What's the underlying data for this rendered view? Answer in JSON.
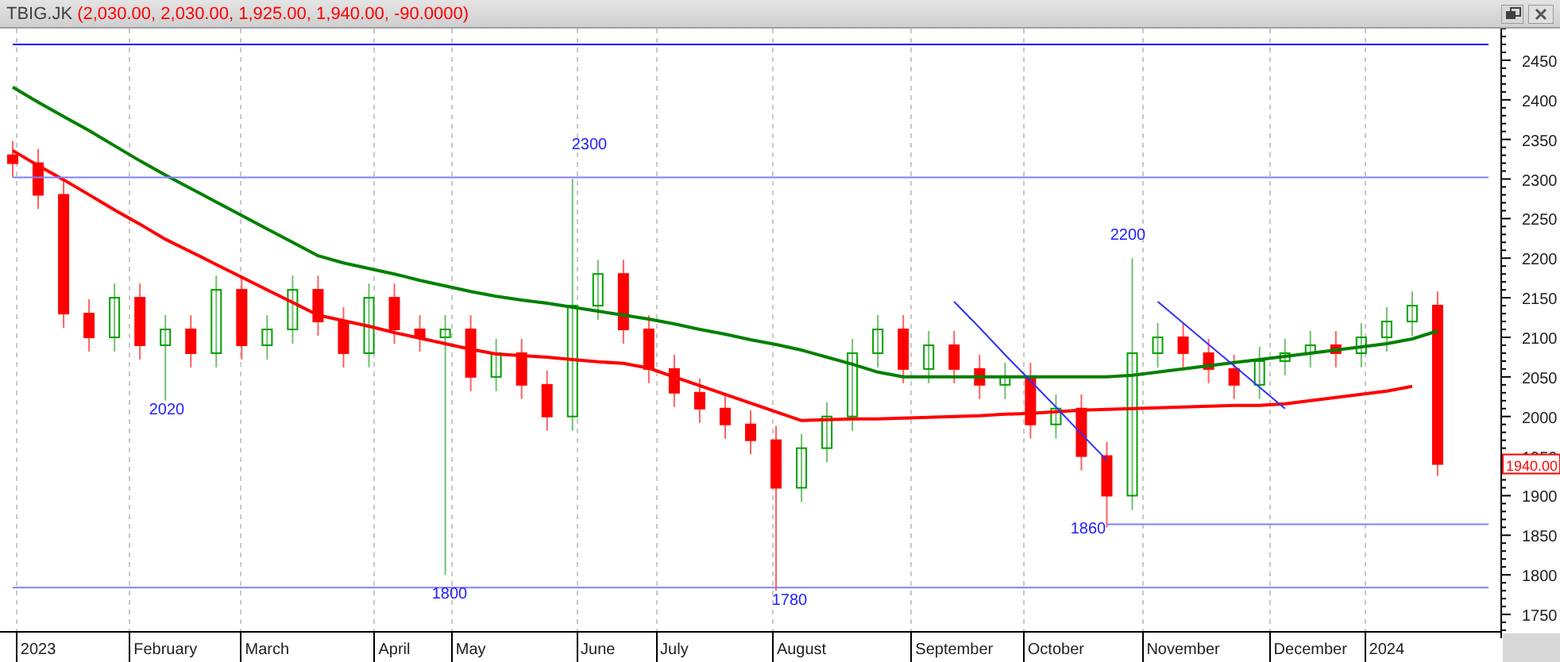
{
  "header": {
    "symbol": "TBIG.JK",
    "ohlc": "(2,030.00, 2,030.00, 1,925.00, 1,940.00, -90.0000)"
  },
  "chart": {
    "last_price_label": "1940.00",
    "chart_data": {
      "type": "candlestick",
      "categories": [
        null,
        "2023",
        null,
        null,
        null,
        null,
        "February",
        null,
        null,
        null,
        "March",
        null,
        null,
        null,
        null,
        "April",
        null,
        null,
        "May",
        null,
        null,
        null,
        null,
        "June",
        null,
        null,
        "July",
        null,
        null,
        null,
        null,
        "August",
        null,
        null,
        null,
        null,
        null,
        "September",
        null,
        null,
        null,
        "October",
        null,
        null,
        null,
        null,
        "November",
        null,
        null,
        null,
        null,
        "December",
        null,
        null,
        "2024",
        null,
        null,
        null,
        null
      ],
      "ylim": [
        1728,
        2490
      ],
      "yticks": [
        1750,
        1800,
        1850,
        1900,
        1950,
        2000,
        2050,
        2100,
        2150,
        2200,
        2250,
        2300,
        2350,
        2400,
        2450
      ],
      "ohlc": [
        [
          2330,
          2348,
          2302,
          2320
        ],
        [
          2320,
          2338,
          2262,
          2280
        ],
        [
          2280,
          2298,
          2112,
          2130
        ],
        [
          2130,
          2148,
          2082,
          2100
        ],
        [
          2100,
          2168,
          2082,
          2150
        ],
        [
          2150,
          2168,
          2072,
          2090
        ],
        [
          2090,
          2128,
          2020,
          2110
        ],
        [
          2110,
          2128,
          2062,
          2080
        ],
        [
          2080,
          2178,
          2062,
          2160
        ],
        [
          2160,
          2178,
          2072,
          2090
        ],
        [
          2090,
          2128,
          2072,
          2110
        ],
        [
          2110,
          2178,
          2092,
          2160
        ],
        [
          2160,
          2178,
          2102,
          2120
        ],
        [
          2120,
          2138,
          2062,
          2080
        ],
        [
          2080,
          2168,
          2062,
          2150
        ],
        [
          2150,
          2168,
          2092,
          2110
        ],
        [
          2110,
          2128,
          2082,
          2100
        ],
        [
          2100,
          2128,
          1800,
          2110
        ],
        [
          2110,
          2128,
          2032,
          2050
        ],
        [
          2050,
          2098,
          2032,
          2080
        ],
        [
          2080,
          2098,
          2022,
          2040
        ],
        [
          2040,
          2058,
          1982,
          2000
        ],
        [
          2000,
          2300,
          1982,
          2140
        ],
        [
          2140,
          2198,
          2122,
          2180
        ],
        [
          2180,
          2198,
          2092,
          2110
        ],
        [
          2110,
          2128,
          2042,
          2060
        ],
        [
          2060,
          2078,
          2012,
          2030
        ],
        [
          2030,
          2048,
          1992,
          2010
        ],
        [
          2010,
          2028,
          1972,
          1990
        ],
        [
          1990,
          2008,
          1952,
          1970
        ],
        [
          1970,
          1988,
          1780,
          1910
        ],
        [
          1910,
          1978,
          1892,
          1960
        ],
        [
          1960,
          2018,
          1942,
          2000
        ],
        [
          2000,
          2098,
          1982,
          2080
        ],
        [
          2080,
          2128,
          2062,
          2110
        ],
        [
          2110,
          2128,
          2042,
          2060
        ],
        [
          2060,
          2108,
          2042,
          2090
        ],
        [
          2090,
          2108,
          2042,
          2060
        ],
        [
          2060,
          2078,
          2022,
          2040
        ],
        [
          2040,
          2068,
          2022,
          2050
        ],
        [
          2050,
          2068,
          1972,
          1990
        ],
        [
          1990,
          2028,
          1972,
          2010
        ],
        [
          2010,
          2028,
          1932,
          1950
        ],
        [
          1950,
          1968,
          1860,
          1900
        ],
        [
          1900,
          2200,
          1882,
          2080
        ],
        [
          2080,
          2118,
          2062,
          2100
        ],
        [
          2100,
          2118,
          2062,
          2080
        ],
        [
          2080,
          2098,
          2042,
          2060
        ],
        [
          2060,
          2078,
          2022,
          2040
        ],
        [
          2040,
          2088,
          2022,
          2070
        ],
        [
          2070,
          2098,
          2052,
          2080
        ],
        [
          2080,
          2108,
          2062,
          2090
        ],
        [
          2090,
          2108,
          2062,
          2080
        ],
        [
          2080,
          2118,
          2062,
          2100
        ],
        [
          2100,
          2138,
          2082,
          2120
        ],
        [
          2120,
          2158,
          2102,
          2140
        ],
        [
          2140,
          2158,
          1925,
          1940
        ],
        null,
        null
      ],
      "series": [
        {
          "type": "line",
          "color": "#008000",
          "values": [
            2416,
            2397,
            2379,
            2361,
            2342,
            2323,
            2305,
            2288,
            2271,
            2254,
            2237,
            2220,
            2203,
            2194,
            2187,
            2180,
            2172,
            2165,
            2158,
            2152,
            2147,
            2143,
            2138,
            2133,
            2128,
            2123,
            2117,
            2110,
            2104,
            2097,
            2091,
            2084,
            2075,
            2066,
            2056,
            2050,
            2050,
            2050,
            2050,
            2050,
            2050,
            2050,
            2050,
            2050,
            2052,
            2056,
            2060,
            2064,
            2068,
            2072,
            2076,
            2080,
            2084,
            2088,
            2092,
            2098,
            2108,
            null,
            null
          ]
        },
        {
          "type": "line",
          "color": "#ff0000",
          "values": [
            2336,
            2317,
            2299,
            2280,
            2261,
            2243,
            2224,
            2208,
            2192,
            2176,
            2160,
            2144,
            2128,
            2121,
            2114,
            2106,
            2099,
            2092,
            2085,
            2079,
            2077,
            2075,
            2072,
            2069,
            2067,
            2061,
            2050,
            2039,
            2028,
            2017,
            2006,
            1995,
            1996,
            1997,
            1997,
            1998,
            1999,
            2000,
            2001,
            2003,
            2004,
            2006,
            2008,
            2009,
            2010,
            2011,
            2012,
            2013,
            2014,
            2014,
            2016,
            2020,
            2024,
            2028,
            2032,
            2038,
            null,
            null,
            null
          ]
        },
        {
          "type": "line",
          "color": "#3030ff",
          "values": [
            null,
            null,
            null,
            null,
            null,
            null,
            null,
            null,
            null,
            null,
            null,
            null,
            null,
            null,
            null,
            null,
            null,
            null,
            null,
            null,
            null,
            null,
            null,
            null,
            null,
            null,
            null,
            null,
            null,
            null,
            null,
            null,
            null,
            null,
            null,
            null,
            null,
            2145,
            2112,
            2078,
            2045,
            2012,
            1978,
            1945,
            null,
            null,
            null,
            null,
            null,
            null,
            null,
            null,
            null,
            null,
            null,
            null,
            null,
            null,
            null
          ]
        },
        {
          "type": "line",
          "color": "#3030ff",
          "values": [
            null,
            null,
            null,
            null,
            null,
            null,
            null,
            null,
            null,
            null,
            null,
            null,
            null,
            null,
            null,
            null,
            null,
            null,
            null,
            null,
            null,
            null,
            null,
            null,
            null,
            null,
            null,
            null,
            null,
            null,
            null,
            null,
            null,
            null,
            null,
            null,
            null,
            null,
            null,
            null,
            null,
            null,
            null,
            null,
            null,
            2145,
            2118,
            2091,
            2064,
            2037,
            2010,
            null,
            null,
            null,
            null,
            null,
            null,
            null,
            null
          ]
        },
        {
          "type": "line",
          "color": "#0000ff",
          "values": [
            2470,
            2470,
            2470,
            2470,
            2470,
            2470,
            2470,
            2470,
            2470,
            2470,
            2470,
            2470,
            2470,
            2470,
            2470,
            2470,
            2470,
            2470,
            2470,
            2470,
            2470,
            2470,
            2470,
            2470,
            2470,
            2470,
            2470,
            2470,
            2470,
            2470,
            2470,
            2470,
            2470,
            2470,
            2470,
            2470,
            2470,
            2470,
            2470,
            2470,
            2470,
            2470,
            2470,
            2470,
            2470,
            2470,
            2470,
            2470,
            2470,
            2470,
            2470,
            2470,
            2470,
            2470,
            2470,
            2470,
            2470,
            2470,
            2470
          ]
        },
        {
          "type": "line",
          "color": "#8080ff",
          "values": [
            2302,
            2302,
            2302,
            2302,
            2302,
            2302,
            2302,
            2302,
            2302,
            2302,
            2302,
            2302,
            2302,
            2302,
            2302,
            2302,
            2302,
            2302,
            2302,
            2302,
            2302,
            2302,
            2302,
            2302,
            2302,
            2302,
            2302,
            2302,
            2302,
            2302,
            2302,
            2302,
            2302,
            2302,
            2302,
            2302,
            2302,
            2302,
            2302,
            2302,
            2302,
            2302,
            2302,
            2302,
            2302,
            2302,
            2302,
            2302,
            2302,
            2302,
            2302,
            2302,
            2302,
            2302,
            2302,
            2302,
            2302,
            2302,
            2302
          ]
        },
        {
          "type": "line",
          "color": "#8080ff",
          "values": [
            null,
            null,
            null,
            null,
            null,
            null,
            null,
            null,
            null,
            null,
            null,
            null,
            null,
            null,
            null,
            null,
            null,
            null,
            null,
            null,
            null,
            null,
            null,
            null,
            null,
            null,
            null,
            null,
            null,
            null,
            null,
            null,
            null,
            null,
            null,
            null,
            null,
            null,
            null,
            null,
            null,
            null,
            null,
            1864,
            1864,
            1864,
            1864,
            1864,
            1864,
            1864,
            1864,
            1864,
            1864,
            1864,
            1864,
            1864,
            1864,
            1864,
            1864
          ]
        },
        {
          "type": "line",
          "color": "#8080ff",
          "values": [
            1784,
            1784,
            1784,
            1784,
            1784,
            1784,
            1784,
            1784,
            1784,
            1784,
            1784,
            1784,
            1784,
            1784,
            1784,
            1784,
            1784,
            1784,
            1784,
            1784,
            1784,
            1784,
            1784,
            1784,
            1784,
            1784,
            1784,
            1784,
            1784,
            1784,
            1784,
            1784,
            1784,
            1784,
            1784,
            1784,
            1784,
            1784,
            1784,
            1784,
            1784,
            1784,
            1784,
            1784,
            1784,
            1784,
            1784,
            1784,
            1784,
            1784,
            1784,
            1784,
            1784,
            1784,
            1784,
            1784,
            1784,
            1784,
            1784
          ]
        }
      ],
      "annotations": [
        "2300",
        "2020",
        "1800",
        "1780",
        "2200",
        "1860"
      ]
    }
  }
}
